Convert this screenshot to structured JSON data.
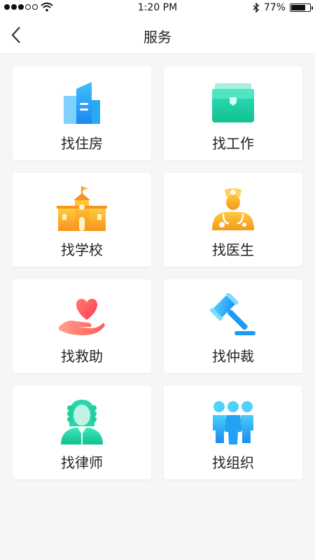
{
  "status_bar": {
    "time": "1:20 PM",
    "battery": "77%",
    "battery_level": 0.77,
    "icons": [
      "signal-dots-icon",
      "wifi-icon",
      "bluetooth-icon",
      "battery-icon"
    ]
  },
  "nav": {
    "title": "服务",
    "back_icon": "chevron-left-icon"
  },
  "services": [
    {
      "label": "找住房",
      "icon": "building-icon"
    },
    {
      "label": "找工作",
      "icon": "briefcase-icon"
    },
    {
      "label": "找学校",
      "icon": "school-icon"
    },
    {
      "label": "找医生",
      "icon": "doctor-icon"
    },
    {
      "label": "找救助",
      "icon": "heart-hand-icon"
    },
    {
      "label": "找仲裁",
      "icon": "gavel-icon"
    },
    {
      "label": "找律师",
      "icon": "lawyer-icon"
    },
    {
      "label": "找组织",
      "icon": "group-icon"
    }
  ],
  "colors": {
    "background": "#f6f6f6",
    "card": "#ffffff",
    "blue": "#2fa7f5",
    "teal": "#22cfa8",
    "orange": "#f6a623",
    "red": "#ff5a5a"
  }
}
